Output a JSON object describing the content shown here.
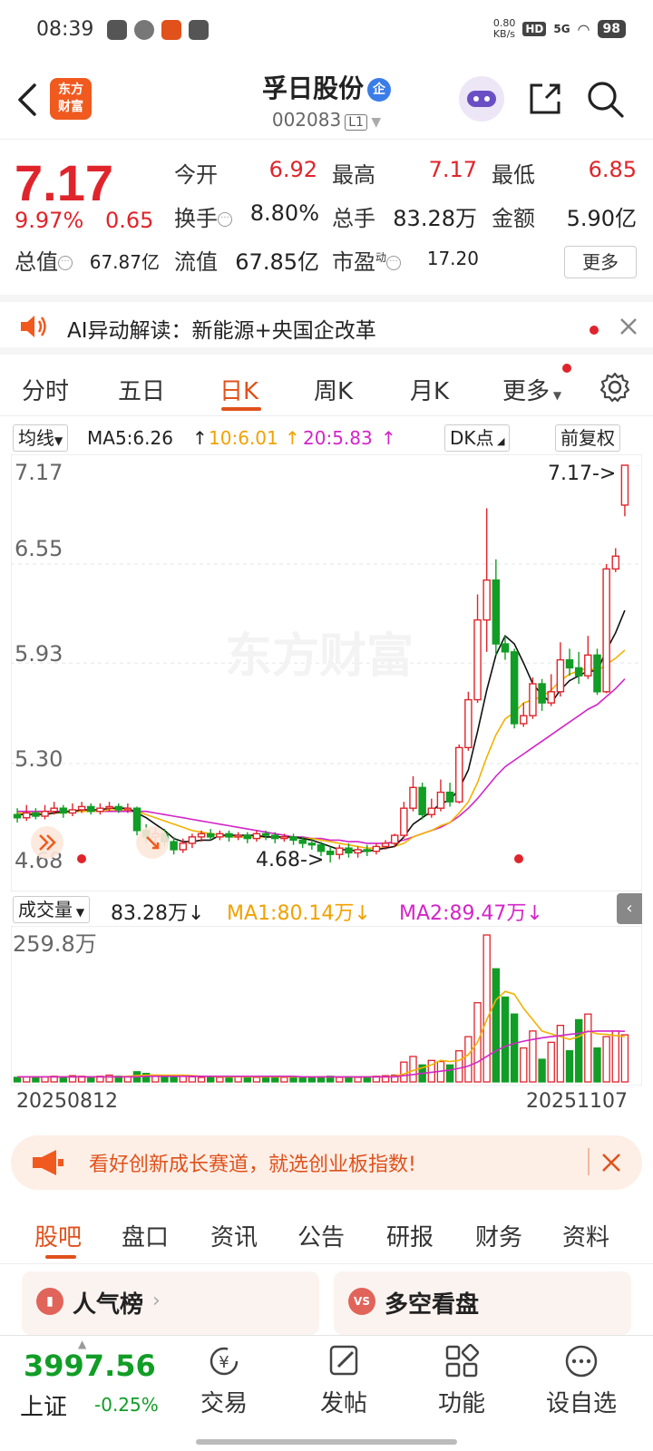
{
  "status": {
    "time": "08:39",
    "net_speed": "0.80\nKB/s",
    "hd": "HD",
    "signal": "5G",
    "battery": "98"
  },
  "header": {
    "logo": "东方\n财富",
    "stock_name": "孚日股份",
    "badge": "企",
    "code": "002083",
    "market": "L1"
  },
  "quote": {
    "price": "7.17",
    "change_pct": "9.97%",
    "change": "0.65",
    "open_label": "今开",
    "open": "6.92",
    "high_label": "最高",
    "high": "7.17",
    "low_label": "最低",
    "low": "6.85",
    "turnover_label": "换手",
    "turnover": "8.80%",
    "volume_label": "总手",
    "volume": "83.28万",
    "amount_label": "金额",
    "amount": "5.90亿",
    "mktcap_label": "总值",
    "mktcap": "67.87亿",
    "float_label": "流值",
    "float": "67.85亿",
    "pe_label": "市盈",
    "pe_sup": "动",
    "pe": "17.20",
    "more": "更多"
  },
  "ai_banner": {
    "text": "AI异动解读：新能源+央国企改革"
  },
  "tabs": [
    "分时",
    "五日",
    "日K",
    "周K",
    "月K",
    "更多"
  ],
  "ma_row": {
    "mode": "均线",
    "ma5": "MA5:6.26",
    "ma10": "10:6.01",
    "ma20": "20:5.83",
    "dk": "DK点",
    "adjust": "前复权"
  },
  "kchart": {
    "y_labels": [
      "7.17",
      "6.55",
      "5.93",
      "5.30",
      "4.68"
    ],
    "max_label": "7.17->",
    "min_label": "4.68->",
    "watermark": "东方财富",
    "colors": {
      "up": "#e0242b",
      "down": "#119d26",
      "ma5": "#111111",
      "ma10": "#f2b200",
      "ma20": "#d325c8"
    }
  },
  "chart_data": {
    "type": "candlestick",
    "y_range": [
      4.68,
      7.17
    ],
    "candles": [
      [
        4.98,
        4.96,
        5.02,
        4.93
      ],
      [
        4.96,
        4.99,
        5.04,
        4.94
      ],
      [
        4.99,
        4.97,
        5.02,
        4.95
      ],
      [
        4.97,
        5.0,
        5.04,
        4.95
      ],
      [
        5.0,
        5.02,
        5.06,
        4.98
      ],
      [
        5.02,
        4.99,
        5.04,
        4.96
      ],
      [
        4.99,
        5.01,
        5.05,
        4.97
      ],
      [
        5.01,
        5.03,
        5.06,
        4.99
      ],
      [
        5.03,
        5.0,
        5.05,
        4.98
      ],
      [
        5.0,
        5.02,
        5.05,
        4.98
      ],
      [
        5.02,
        5.03,
        5.06,
        5.0
      ],
      [
        5.03,
        5.01,
        5.05,
        4.99
      ],
      [
        5.01,
        5.02,
        5.05,
        4.99
      ],
      [
        5.02,
        4.88,
        5.03,
        4.85
      ],
      [
        4.88,
        4.84,
        4.92,
        4.8
      ],
      [
        4.84,
        4.86,
        4.9,
        4.8
      ],
      [
        4.86,
        4.81,
        4.89,
        4.78
      ],
      [
        4.81,
        4.76,
        4.84,
        4.73
      ],
      [
        4.76,
        4.8,
        4.83,
        4.74
      ],
      [
        4.8,
        4.84,
        4.86,
        4.77
      ],
      [
        4.84,
        4.86,
        4.88,
        4.81
      ],
      [
        4.86,
        4.84,
        4.89,
        4.82
      ],
      [
        4.84,
        4.86,
        4.88,
        4.82
      ],
      [
        4.86,
        4.84,
        4.88,
        4.81
      ],
      [
        4.84,
        4.85,
        4.87,
        4.82
      ],
      [
        4.85,
        4.83,
        4.87,
        4.8
      ],
      [
        4.83,
        4.86,
        4.88,
        4.81
      ],
      [
        4.86,
        4.85,
        4.88,
        4.82
      ],
      [
        4.85,
        4.83,
        4.87,
        4.8
      ],
      [
        4.83,
        4.84,
        4.86,
        4.81
      ],
      [
        4.84,
        4.82,
        4.86,
        4.79
      ],
      [
        4.82,
        4.8,
        4.84,
        4.77
      ],
      [
        4.8,
        4.79,
        4.83,
        4.76
      ],
      [
        4.79,
        4.75,
        4.81,
        4.72
      ],
      [
        4.75,
        4.73,
        4.78,
        4.68
      ],
      [
        4.73,
        4.77,
        4.79,
        4.7
      ],
      [
        4.77,
        4.74,
        4.8,
        4.71
      ],
      [
        4.74,
        4.76,
        4.78,
        4.71
      ],
      [
        4.76,
        4.75,
        4.79,
        4.72
      ],
      [
        4.75,
        4.78,
        4.8,
        4.73
      ],
      [
        4.78,
        4.8,
        4.82,
        4.76
      ],
      [
        4.8,
        4.85,
        4.86,
        4.78
      ],
      [
        4.85,
        5.02,
        5.06,
        4.83
      ],
      [
        5.02,
        5.15,
        5.22,
        5.0
      ],
      [
        5.15,
        4.98,
        5.18,
        4.95
      ],
      [
        4.98,
        5.02,
        5.08,
        4.96
      ],
      [
        5.02,
        5.12,
        5.2,
        5.0
      ],
      [
        5.12,
        5.06,
        5.18,
        5.03
      ],
      [
        5.06,
        5.4,
        5.42,
        5.05
      ],
      [
        5.4,
        5.7,
        5.75,
        5.38
      ],
      [
        5.7,
        6.2,
        6.36,
        5.68
      ],
      [
        6.2,
        6.45,
        6.9,
        6.0
      ],
      [
        6.45,
        6.05,
        6.58,
        5.98
      ],
      [
        6.05,
        6.0,
        6.1,
        5.95
      ],
      [
        6.0,
        5.55,
        6.02,
        5.52
      ],
      [
        5.55,
        5.6,
        5.68,
        5.53
      ],
      [
        5.6,
        5.8,
        5.84,
        5.58
      ],
      [
        5.8,
        5.68,
        5.83,
        5.63
      ],
      [
        5.68,
        5.75,
        5.86,
        5.66
      ],
      [
        5.75,
        5.95,
        6.06,
        5.72
      ],
      [
        5.95,
        5.9,
        6.02,
        5.85
      ],
      [
        5.9,
        5.85,
        6.0,
        5.8
      ],
      [
        5.85,
        5.98,
        6.1,
        5.83
      ],
      [
        5.98,
        5.75,
        6.02,
        5.73
      ],
      [
        5.75,
        6.52,
        6.55,
        5.74
      ],
      [
        6.52,
        6.6,
        6.65,
        6.5
      ],
      [
        6.92,
        7.17,
        7.17,
        6.85
      ]
    ],
    "ma5": [
      4.98,
      4.98,
      4.98,
      4.98,
      4.99,
      5.0,
      5.0,
      5.01,
      5.01,
      5.01,
      5.02,
      5.02,
      5.02,
      4.99,
      4.96,
      4.92,
      4.88,
      4.83,
      4.81,
      4.81,
      4.82,
      4.82,
      4.85,
      4.85,
      4.85,
      4.85,
      4.85,
      4.84,
      4.84,
      4.84,
      4.84,
      4.83,
      4.82,
      4.8,
      4.78,
      4.76,
      4.76,
      4.75,
      4.75,
      4.76,
      4.77,
      4.78,
      4.84,
      4.92,
      4.96,
      5.0,
      5.05,
      5.07,
      5.14,
      5.26,
      5.5,
      5.76,
      5.98,
      6.1,
      6.05,
      5.93,
      5.8,
      5.73,
      5.68,
      5.76,
      5.82,
      5.85,
      5.88,
      5.88,
      6.01,
      6.12,
      6.26
    ],
    "ma10": [
      4.99,
      4.99,
      4.99,
      4.99,
      4.99,
      4.99,
      5.0,
      5.0,
      5.0,
      5.0,
      5.01,
      5.01,
      5.01,
      5.0,
      4.98,
      4.96,
      4.94,
      4.92,
      4.9,
      4.88,
      4.87,
      4.86,
      4.85,
      4.84,
      4.84,
      4.84,
      4.84,
      4.84,
      4.84,
      4.84,
      4.84,
      4.83,
      4.83,
      4.82,
      4.81,
      4.8,
      4.79,
      4.78,
      4.77,
      4.77,
      4.77,
      4.78,
      4.8,
      4.84,
      4.86,
      4.88,
      4.91,
      4.93,
      4.99,
      5.06,
      5.18,
      5.34,
      5.48,
      5.58,
      5.62,
      5.68,
      5.7,
      5.72,
      5.76,
      5.82,
      5.86,
      5.88,
      5.9,
      5.88,
      5.92,
      5.96,
      6.01
    ],
    "ma20": [
      5.0,
      5.0,
      5.0,
      5.0,
      5.0,
      5.0,
      5.0,
      5.0,
      5.0,
      5.0,
      5.0,
      5.0,
      5.0,
      5.0,
      5.0,
      4.99,
      4.98,
      4.97,
      4.96,
      4.95,
      4.94,
      4.93,
      4.92,
      4.91,
      4.9,
      4.89,
      4.88,
      4.87,
      4.86,
      4.85,
      4.84,
      4.84,
      4.83,
      4.83,
      4.82,
      4.82,
      4.81,
      4.81,
      4.8,
      4.8,
      4.8,
      4.81,
      4.82,
      4.84,
      4.86,
      4.88,
      4.9,
      4.93,
      4.97,
      5.02,
      5.08,
      5.15,
      5.22,
      5.28,
      5.32,
      5.36,
      5.4,
      5.44,
      5.48,
      5.52,
      5.56,
      5.6,
      5.64,
      5.67,
      5.72,
      5.77,
      5.83
    ],
    "volume_max": 259.8,
    "volume": [
      8,
      9,
      7,
      9,
      10,
      8,
      11,
      10,
      9,
      10,
      12,
      10,
      9,
      18,
      15,
      12,
      10,
      9,
      10,
      9,
      8,
      9,
      8,
      8,
      9,
      8,
      8,
      9,
      8,
      8,
      9,
      8,
      8,
      9,
      10,
      8,
      9,
      8,
      9,
      10,
      11,
      12,
      35,
      45,
      30,
      38,
      36,
      30,
      55,
      80,
      140,
      259.8,
      200,
      150,
      120,
      60,
      90,
      40,
      70,
      100,
      55,
      110,
      120,
      60,
      80,
      90,
      83.28
    ],
    "vol_ma1": [
      9,
      9,
      9,
      9,
      9,
      9,
      9,
      9,
      9,
      9,
      9,
      9,
      10,
      11,
      12,
      12,
      12,
      12,
      12,
      11,
      10,
      10,
      9,
      9,
      9,
      9,
      9,
      9,
      9,
      9,
      9,
      9,
      9,
      9,
      9,
      9,
      9,
      9,
      9,
      9,
      9,
      10,
      14,
      20,
      25,
      30,
      38,
      36,
      38,
      48,
      70,
      110,
      145,
      160,
      155,
      130,
      110,
      90,
      85,
      80,
      75,
      80,
      90,
      85,
      84,
      82,
      80.14
    ],
    "vol_ma2": [
      9,
      9,
      9,
      9,
      9,
      9,
      9,
      9,
      9,
      9,
      9,
      9,
      9,
      9,
      10,
      10,
      10,
      10,
      10,
      10,
      10,
      10,
      10,
      10,
      10,
      10,
      10,
      10,
      10,
      10,
      10,
      9,
      9,
      9,
      9,
      9,
      9,
      9,
      9,
      9,
      9,
      9,
      11,
      13,
      15,
      17,
      19,
      21,
      24,
      28,
      35,
      45,
      55,
      63,
      68,
      72,
      75,
      78,
      80,
      82,
      84,
      86,
      89,
      90,
      90,
      90,
      89.47
    ],
    "dates": [
      "20250812",
      "20251107"
    ]
  },
  "vol_row": {
    "mode": "成交量",
    "vol": "83.28万↓",
    "ma1": "MA1:80.14万↓",
    "ma2": "MA2:89.47万↓",
    "max_label": "259.8万"
  },
  "ad": {
    "text": "看好创新成长赛道，就选创业板指数!"
  },
  "bottom_tabs": [
    "股吧",
    "盘口",
    "资讯",
    "公告",
    "研报",
    "财务",
    "资料"
  ],
  "cards": [
    {
      "label": "人气榜",
      "icon": "bar-chart-icon"
    },
    {
      "label": "多空看盘",
      "icon": "vs-icon"
    }
  ],
  "nav": {
    "index_value": "3997.56",
    "index_name": "上证",
    "index_change": "-0.25%",
    "items": [
      "交易",
      "发帖",
      "功能",
      "设自选"
    ]
  }
}
